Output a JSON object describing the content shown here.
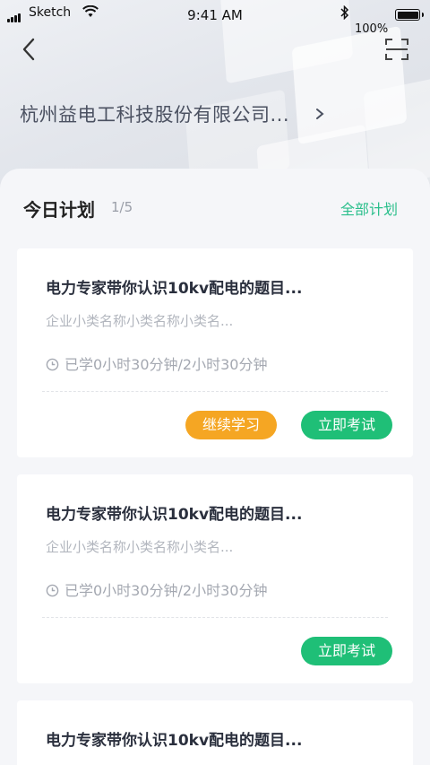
{
  "status_bar": {
    "carrier": "Sketch",
    "time": "9:41 AM",
    "battery": "100%"
  },
  "header": {
    "company": "杭州益电工科技股份有限公司..."
  },
  "plan": {
    "title": "今日计划",
    "count": "1/5",
    "all_label": "全部计划"
  },
  "cards": [
    {
      "title": "电力专家带你认识10kv配电的题目...",
      "subtitle": "企业小类名称小类名称小类名...",
      "progress": "已学0小时30分钟/2小时30分钟",
      "continue_label": "继续学习",
      "exam_label": "立即考试"
    },
    {
      "title": "电力专家带你认识10kv配电的题目...",
      "subtitle": "企业小类名称小类名称小类名...",
      "progress": "已学0小时30分钟/2小时30分钟",
      "exam_label": "立即考试"
    },
    {
      "title": "电力专家带你认识10kv配电的题目..."
    }
  ],
  "colors": {
    "accent": "#2bbf8c",
    "continue": "#f5a623",
    "exam": "#1fbf77"
  }
}
